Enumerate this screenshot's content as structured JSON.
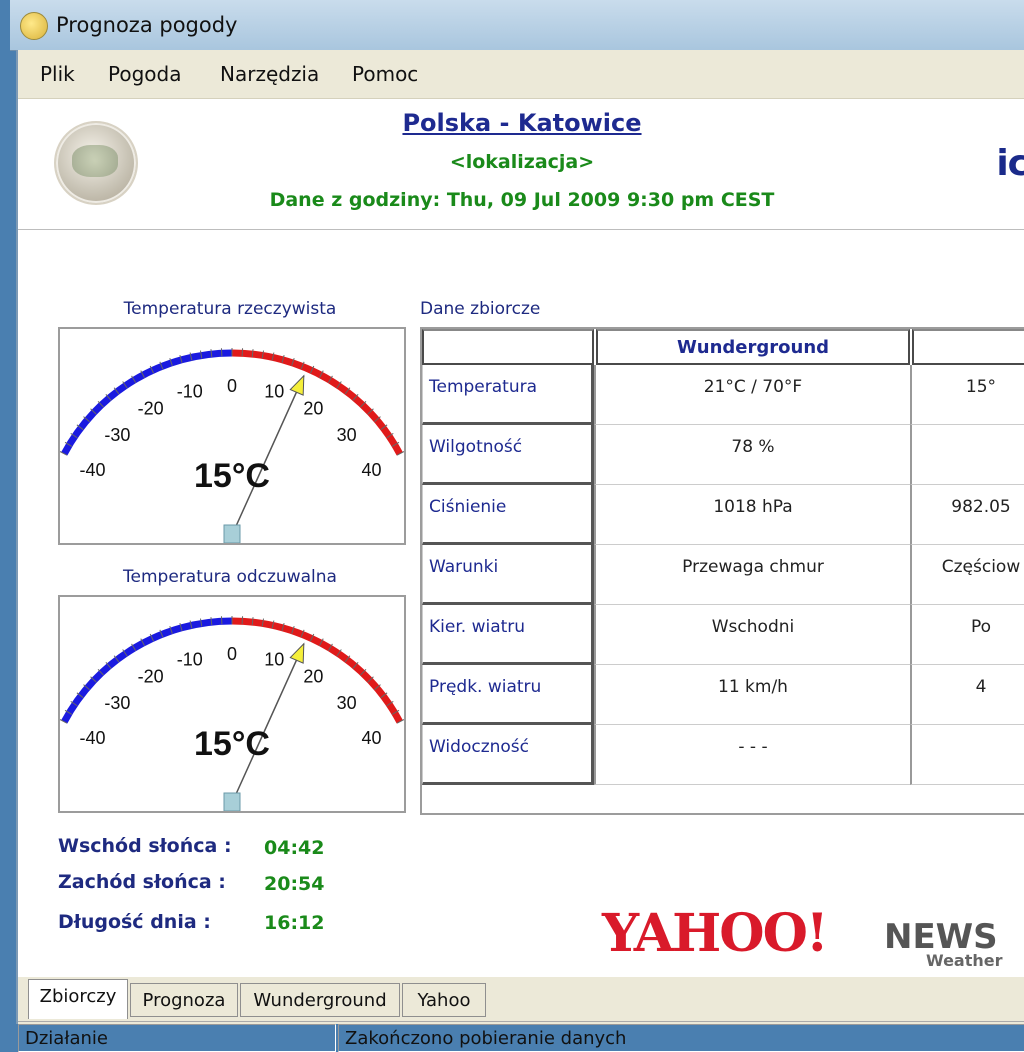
{
  "window": {
    "title": "Prognoza pogody"
  },
  "menu": [
    "Plik",
    "Pogoda",
    "Narzędzia",
    "Pomoc"
  ],
  "header": {
    "location": "Polska - Katowice",
    "localization": "<lokalizacja>",
    "data_time": "Dane z godziny: Thu, 09 Jul 2009 9:30 pm CEST",
    "logo_text": "ic"
  },
  "gauges": [
    {
      "title": "Temperatura rzeczywista",
      "value": 15,
      "value_text": "15°C",
      "ticks": [
        "-40",
        "-30",
        "-20",
        "-10",
        "0",
        "10",
        "20",
        "30",
        "40"
      ],
      "min": -40,
      "max": 40
    },
    {
      "title": "Temperatura odczuwalna",
      "value": 15,
      "value_text": "15°C",
      "ticks": [
        "-40",
        "-30",
        "-20",
        "-10",
        "0",
        "10",
        "20",
        "30",
        "40"
      ],
      "min": -40,
      "max": 40
    }
  ],
  "sun": [
    {
      "label": "Wschód słońca :",
      "value": "04:42"
    },
    {
      "label": "Zachód słońca :",
      "value": "20:54"
    },
    {
      "label": "Długość dnia :",
      "value": "16:12"
    }
  ],
  "table": {
    "title": "Dane zbiorcze",
    "columns": [
      "",
      "Wunderground",
      ""
    ],
    "rows": [
      {
        "label": "Temperatura",
        "wunder": "21°C / 70°F",
        "yahoo": "15°"
      },
      {
        "label": "Wilgotność",
        "wunder": "78 %",
        "yahoo": ""
      },
      {
        "label": "Ciśnienie",
        "wunder": "1018 hPa",
        "yahoo": "982.05"
      },
      {
        "label": "Warunki",
        "wunder": "Przewaga chmur",
        "yahoo": "Częściow"
      },
      {
        "label": "Kier. wiatru",
        "wunder": "Wschodni",
        "yahoo": "Po"
      },
      {
        "label": "Prędk. wiatru",
        "wunder": "11 km/h",
        "yahoo": "4"
      },
      {
        "label": "Widoczność",
        "wunder": "- - -",
        "yahoo": ""
      }
    ]
  },
  "brand": {
    "yahoo": "YAHOO!",
    "news": "NEWS",
    "weather": "Weather"
  },
  "tabs": [
    "Zbiorczy",
    "Prognoza",
    "Wunderground",
    "Yahoo"
  ],
  "status": [
    "Działanie",
    "Zakończono pobieranie danych"
  ]
}
